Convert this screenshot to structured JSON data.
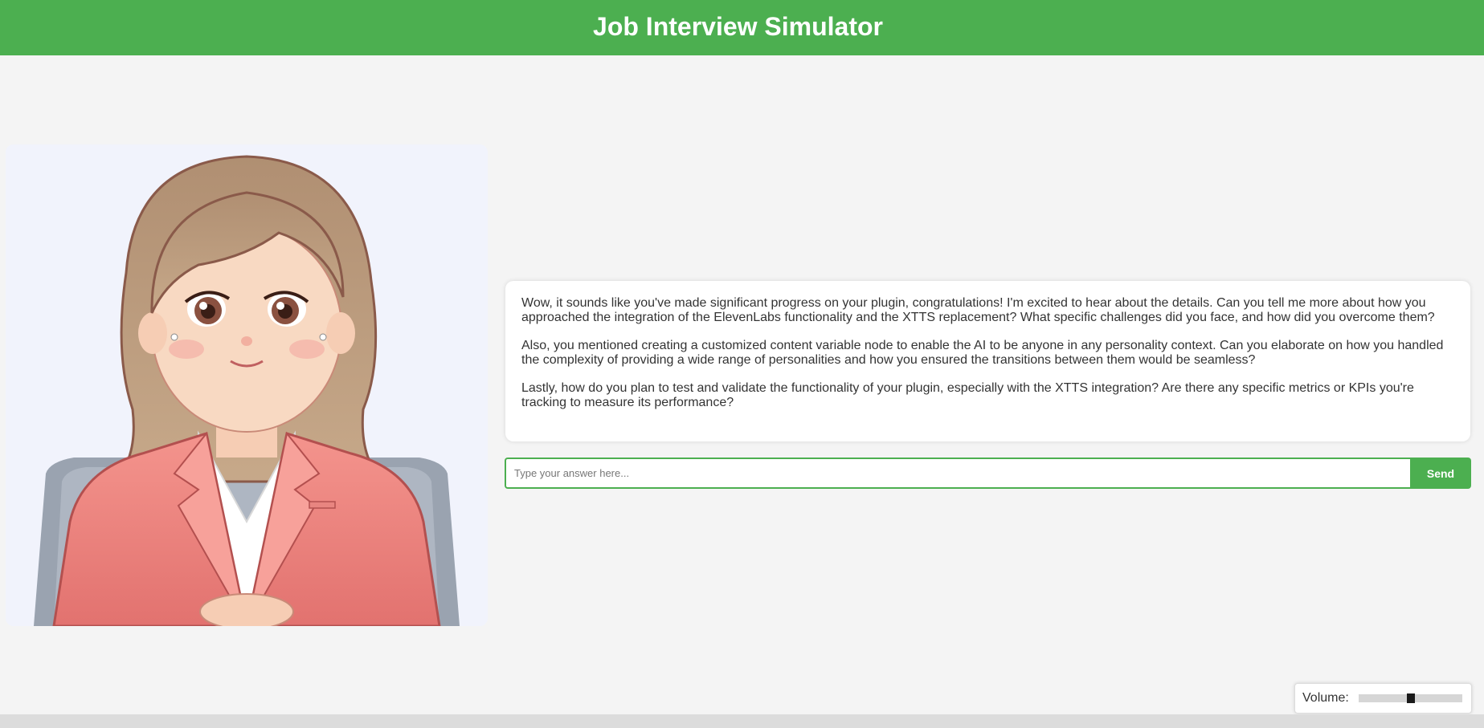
{
  "header": {
    "title": "Job Interview Simulator"
  },
  "avatar": {
    "icon": "interviewer-avatar"
  },
  "message": {
    "paragraphs": [
      "Wow, it sounds like you've made significant progress on your plugin, congratulations! I'm excited to hear about the details. Can you tell me more about how you approached the integration of the ElevenLabs functionality and the XTTS replacement? What specific challenges did you face, and how did you overcome them?",
      "Also, you mentioned creating a customized content variable node to enable the AI to be anyone in any personality context. Can you elaborate on how you handled the complexity of providing a wide range of personalities and how you ensured the transitions between them would be seamless?",
      "Lastly, how do you plan to test and validate the functionality of your plugin, especially with the XTTS integration? Are there any specific metrics or KPIs you're tracking to measure its performance?"
    ]
  },
  "answer": {
    "placeholder": "Type your answer here...",
    "value": "",
    "send_label": "Send"
  },
  "volume": {
    "label": "Volume:",
    "level": 0.5
  },
  "colors": {
    "accent": "#4caf50",
    "background": "#f4f4f4",
    "card": "#ffffff"
  }
}
